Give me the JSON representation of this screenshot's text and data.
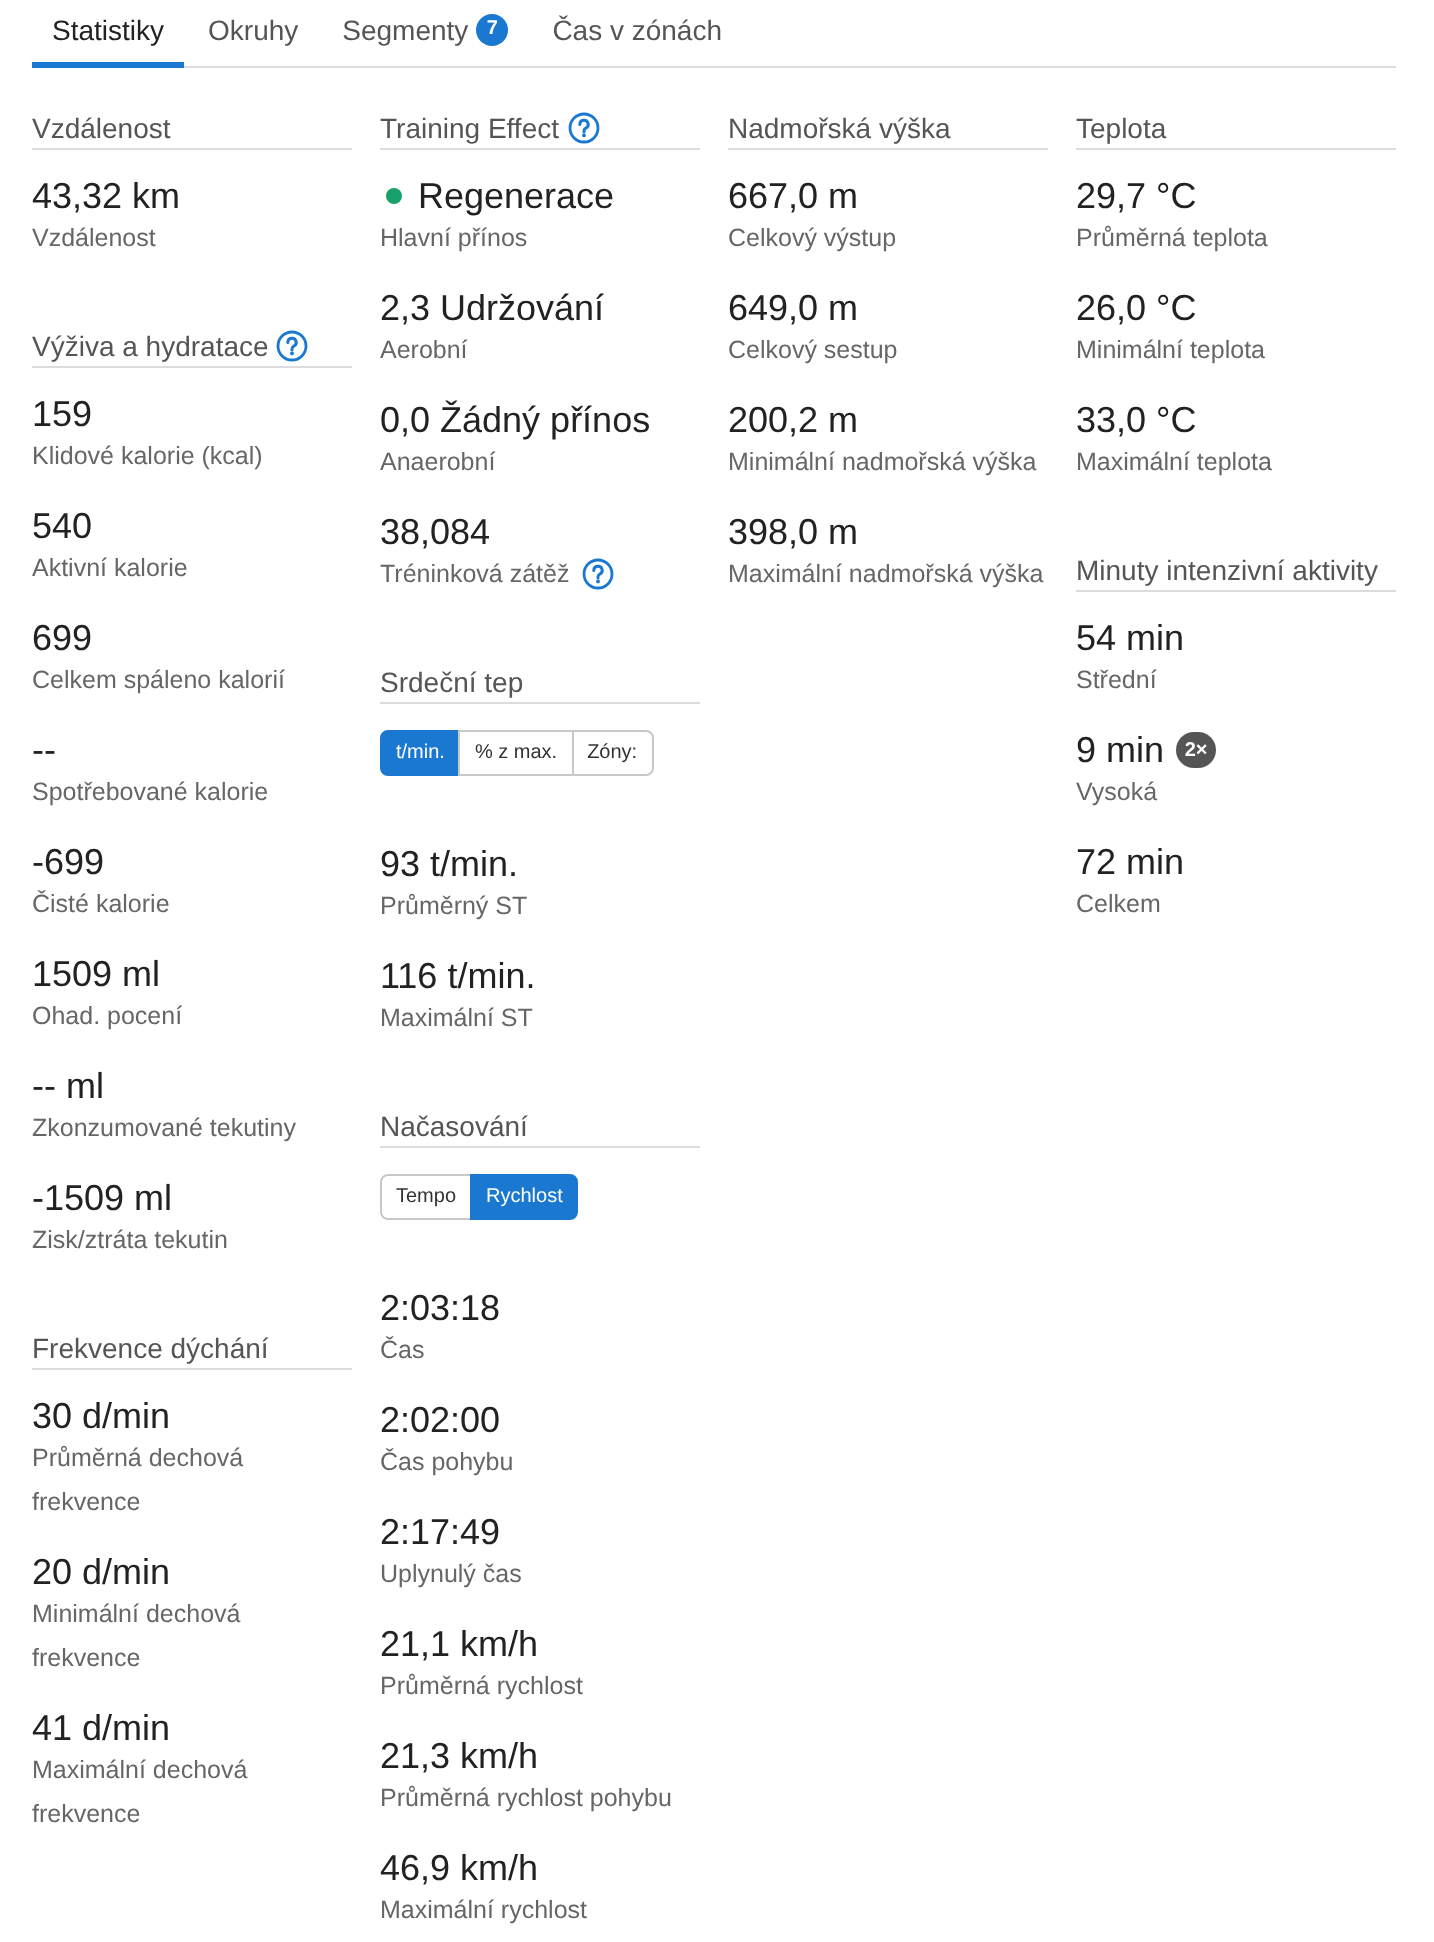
{
  "tabs": [
    {
      "label": "Statistiky",
      "selected": true
    },
    {
      "label": "Okruhy",
      "selected": false
    },
    {
      "label": "Segmenty",
      "selected": false,
      "badge": "7"
    },
    {
      "label": "Čas v zónách",
      "selected": false
    }
  ],
  "columns": [
    {
      "sections": [
        {
          "title": "Vzdálenost",
          "help": false,
          "stats": [
            {
              "value": "43,32 km",
              "label": "Vzdálenost"
            }
          ]
        },
        {
          "title": "Výživa a hydratace",
          "help": true,
          "stats": [
            {
              "value": "159",
              "label": "Klidové kalorie (kcal)"
            },
            {
              "value": "540",
              "label": "Aktivní kalorie"
            },
            {
              "value": "699",
              "label": "Celkem spáleno kalorií"
            },
            {
              "value": "--",
              "label": "Spotřebované kalorie"
            },
            {
              "value": "-699",
              "label": "Čisté kalorie"
            },
            {
              "value": "1509 ml",
              "label": "Ohad. pocení"
            },
            {
              "value": "-- ml",
              "label": "Zkonzumované tekutiny"
            },
            {
              "value": "-1509 ml",
              "label": "Zisk/ztráta tekutin"
            }
          ]
        },
        {
          "title": "Frekvence dýchání",
          "help": false,
          "stats": [
            {
              "value": "30 d/min",
              "label": "Průměrná dechová frekvence"
            },
            {
              "value": "20 d/min",
              "label": "Minimální dechová frekvence"
            },
            {
              "value": "41 d/min",
              "label": "Maximální dechová frekvence"
            }
          ]
        }
      ]
    },
    {
      "sections": [
        {
          "title": "Training Effect",
          "help": true,
          "stats": [
            {
              "value": "Regenerace",
              "label": "Hlavní přínos",
              "color": "#1aa06d"
            },
            {
              "value": "2,3 Udržování",
              "label": "Aerobní"
            },
            {
              "value": "0,0 Žádný přínos",
              "label": "Anaerobní"
            },
            {
              "value": "38,084",
              "label": "Tréninková zátěž",
              "help": true
            }
          ]
        },
        {
          "title": "Srdeční tep",
          "help": false,
          "toggle": [
            {
              "label": "t/min.",
              "selected": true
            },
            {
              "label": "% z max.",
              "selected": false
            },
            {
              "label": "Zóny:",
              "selected": false
            }
          ],
          "stats": [
            {
              "value": "93 t/min.",
              "label": "Průměrný ST"
            },
            {
              "value": "116 t/min.",
              "label": "Maximální ST"
            }
          ]
        },
        {
          "title": "Načasování",
          "help": false,
          "toggle": [
            {
              "label": "Tempo",
              "selected": false
            },
            {
              "label": "Rychlost",
              "selected": true
            }
          ],
          "stats": [
            {
              "value": "2:03:18",
              "label": "Čas"
            },
            {
              "value": "2:02:00",
              "label": "Čas pohybu"
            },
            {
              "value": "2:17:49",
              "label": "Uplynulý čas"
            },
            {
              "value": "21,1 km/h",
              "label": "Průměrná rychlost"
            },
            {
              "value": "21,3 km/h",
              "label": "Průměrná rychlost pohybu"
            },
            {
              "value": "46,9 km/h",
              "label": "Maximální rychlost"
            }
          ]
        }
      ]
    },
    {
      "sections": [
        {
          "title": "Nadmořská výška",
          "help": false,
          "stats": [
            {
              "value": "667,0 m",
              "label": "Celkový výstup"
            },
            {
              "value": "649,0 m",
              "label": "Celkový sestup"
            },
            {
              "value": "200,2 m",
              "label": "Minimální nadmořská výška"
            },
            {
              "value": "398,0 m",
              "label": "Maximální nadmořská výška"
            }
          ]
        }
      ]
    },
    {
      "sections": [
        {
          "title": "Teplota",
          "help": false,
          "stats": [
            {
              "value": "29,7 °C",
              "label": "Průměrná teplota"
            },
            {
              "value": "26,0 °C",
              "label": "Minimální teplota"
            },
            {
              "value": "33,0 °C",
              "label": "Maximální teplota"
            }
          ]
        },
        {
          "title": "Minuty intenzivní aktivity",
          "help": false,
          "stats": [
            {
              "value": "54 min",
              "label": "Střední"
            },
            {
              "value": "9 min",
              "label": "Vysoká",
              "badge": "2×"
            },
            {
              "value": "72 min",
              "label": "Celkem"
            }
          ]
        }
      ]
    }
  ]
}
